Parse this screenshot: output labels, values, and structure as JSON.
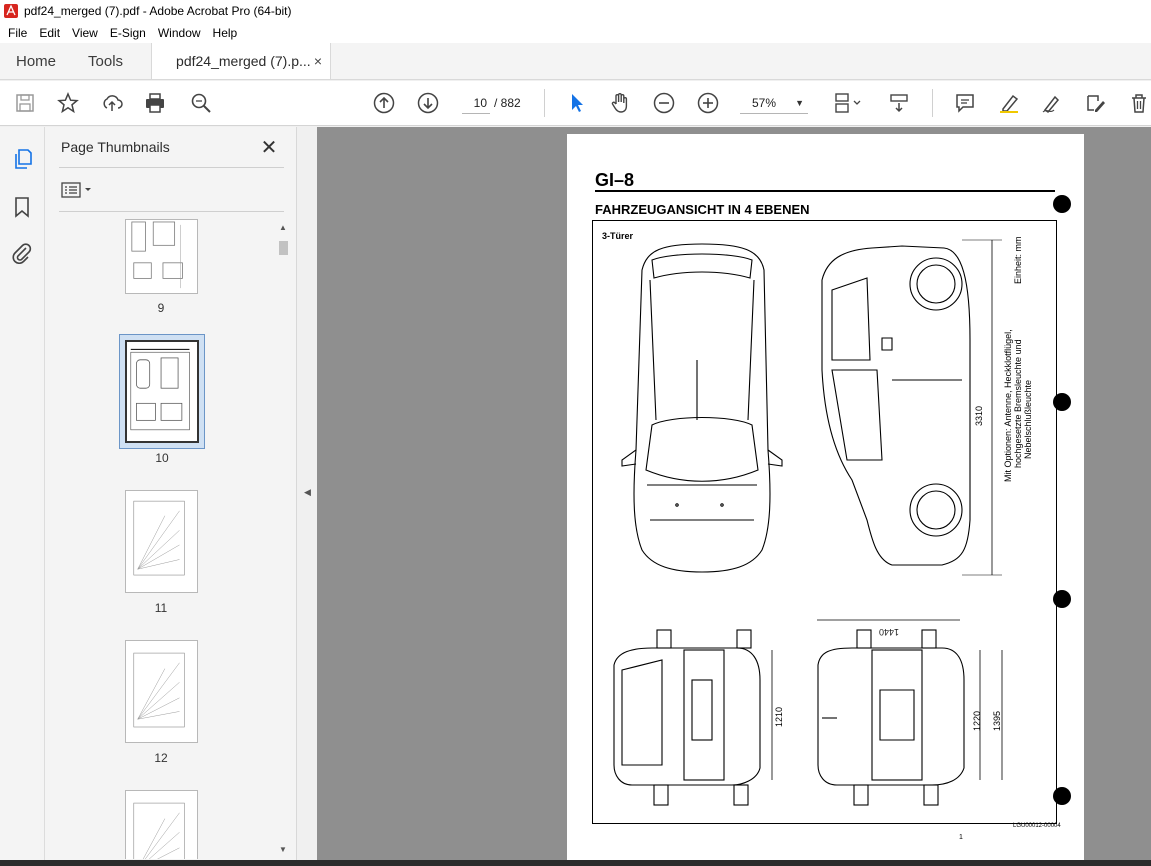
{
  "window": {
    "title": "pdf24_merged (7).pdf - Adobe Acrobat Pro (64-bit)"
  },
  "menu": {
    "items": [
      "File",
      "Edit",
      "View",
      "E-Sign",
      "Window",
      "Help"
    ]
  },
  "tabs": {
    "home": "Home",
    "tools": "Tools",
    "document": "pdf24_merged (7).p...",
    "close": "×"
  },
  "toolbar": {
    "current_page": "10",
    "page_total": "/ 882",
    "zoom": "57%",
    "icons": [
      "save-icon",
      "star-icon",
      "upload-icon",
      "print-icon",
      "zoom-search-icon",
      "prev-page-icon",
      "next-page-icon",
      "select-cursor-icon",
      "hand-icon",
      "zoom-out-icon",
      "zoom-in-icon",
      "page-layout-icon",
      "scroll-icon",
      "comment-icon",
      "highlight-icon",
      "sign-icon",
      "edit-text-icon",
      "delete-icon"
    ]
  },
  "thumbnails_panel": {
    "title": "Page Thumbnails",
    "close": "✕",
    "pages": [
      {
        "label": "9"
      },
      {
        "label": "10",
        "selected": true
      },
      {
        "label": "11"
      },
      {
        "label": "12"
      },
      {
        "label": ""
      }
    ]
  },
  "document": {
    "page_title": "GI–8",
    "heading": "FAHRZEUGANSICHT IN 4 EBENEN",
    "subheading": "3-Türer",
    "unit_note": "Einheit: mm",
    "options_note_1": "Mit Optionen: Antenne, Heckklotflügel,",
    "options_note_2": "hochgesetzte Bremsleuchte und",
    "options_note_3": "Nebelschlußleuchte",
    "dim_length": "3310",
    "dim_width": "1440",
    "dim_rear_height": "1210",
    "dim_front_height": "1220",
    "dim_total_height": "1395",
    "code": "LGU00012-00004",
    "page_mark": "1"
  }
}
